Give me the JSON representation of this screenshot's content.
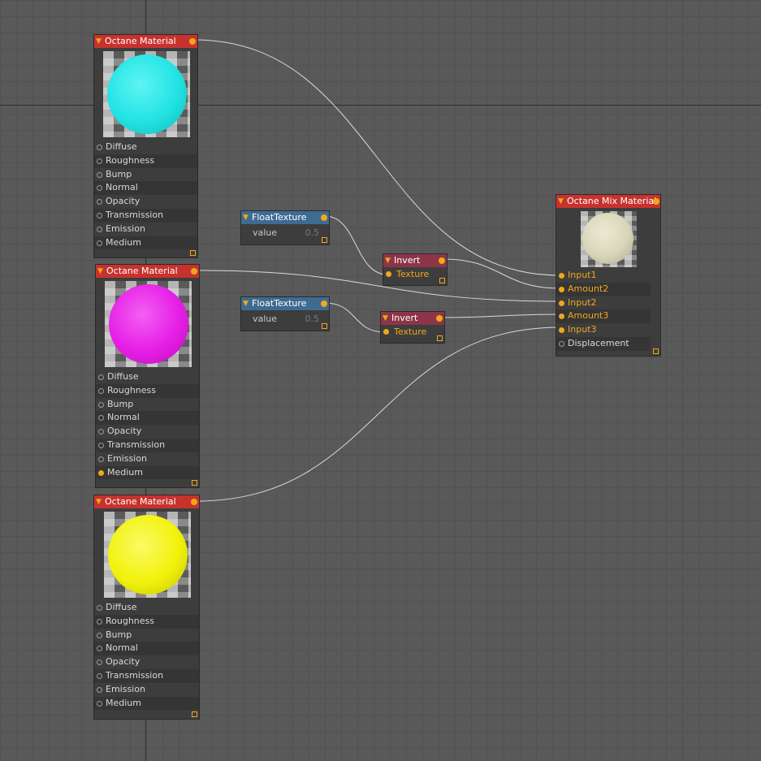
{
  "canvas": {
    "background": "#595959",
    "wire_color": "#d9d9d9",
    "pin_color": "#f0a81a"
  },
  "materials": [
    {
      "title": "Octane Material",
      "sphere_color": "#22e3e3",
      "ports": [
        "Diffuse",
        "Roughness",
        "Bump",
        "Normal",
        "Opacity",
        "Transmission",
        "Emission",
        "Medium"
      ],
      "connected_ports": []
    },
    {
      "title": "Octane Material",
      "sphere_color": "#e61ee6",
      "ports": [
        "Diffuse",
        "Roughness",
        "Bump",
        "Normal",
        "Opacity",
        "Transmission",
        "Emission",
        "Medium"
      ],
      "connected_ports": [
        "Medium"
      ]
    },
    {
      "title": "Octane Material",
      "sphere_color": "#f2f20a",
      "ports": [
        "Diffuse",
        "Roughness",
        "Bump",
        "Normal",
        "Opacity",
        "Transmission",
        "Emission",
        "Medium"
      ],
      "connected_ports": []
    }
  ],
  "float_textures": [
    {
      "title": "FloatTexture",
      "label": "value",
      "value": "0.5"
    },
    {
      "title": "FloatTexture",
      "label": "value",
      "value": "0.5"
    }
  ],
  "inverts": [
    {
      "title": "Invert",
      "input": "Texture"
    },
    {
      "title": "Invert",
      "input": "Texture"
    }
  ],
  "mix": {
    "title": "Octane Mix Material",
    "sphere_color": "#d8d6b8",
    "ports": [
      "Input1",
      "Amount2",
      "Input2",
      "Amount3",
      "Input3",
      "Displacement"
    ],
    "connected_ports": [
      "Input1",
      "Amount2",
      "Input2",
      "Amount3",
      "Input3"
    ]
  }
}
